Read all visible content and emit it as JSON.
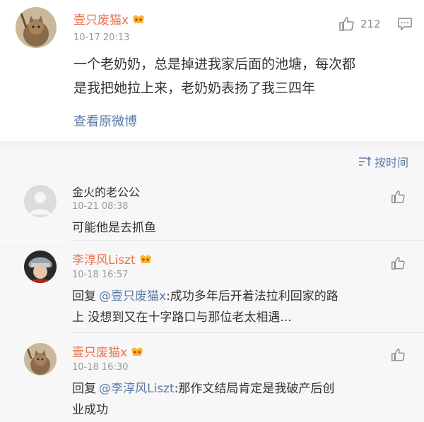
{
  "post": {
    "author": "壹只废猫x",
    "time": "10-17 20:13",
    "like_count": "212",
    "text_line1": "一个老奶奶，总是掉进我家后面的池塘，每次都",
    "text_line2": "是我把她拉上来，老奶奶表扬了我三四年",
    "view_original": "查看原微博"
  },
  "sort": {
    "label": "按时间"
  },
  "comments": [
    {
      "author": "金火的老公公",
      "time": "10-21 08:38",
      "text_line1": "可能他是去抓鱼",
      "text_line2": ""
    },
    {
      "author": "李淳风Liszt",
      "time": "10-18 16:57",
      "reply_prefix": "回复",
      "mention": "@壹只废猫x",
      "text_line1_rest": ":成功多年后开着法拉利回家的路",
      "text_line2": "上 没想到又在十字路口与那位老太相遇..."
    },
    {
      "author": "壹只废猫x",
      "time": "10-18 16:30",
      "reply_prefix": "回复",
      "mention": "@李淳风Liszt",
      "text_line1_rest": ":那作文结局肯定是我破产后创",
      "text_line2": "业成功"
    }
  ],
  "colors": {
    "name": "#eb7350",
    "link": "#5a7ba8",
    "time": "#999999",
    "background_comments": "#f7f7f7"
  },
  "icons": [
    "thumbs-up-icon",
    "comment-icon",
    "sort-icon",
    "vip-badge-icon"
  ]
}
